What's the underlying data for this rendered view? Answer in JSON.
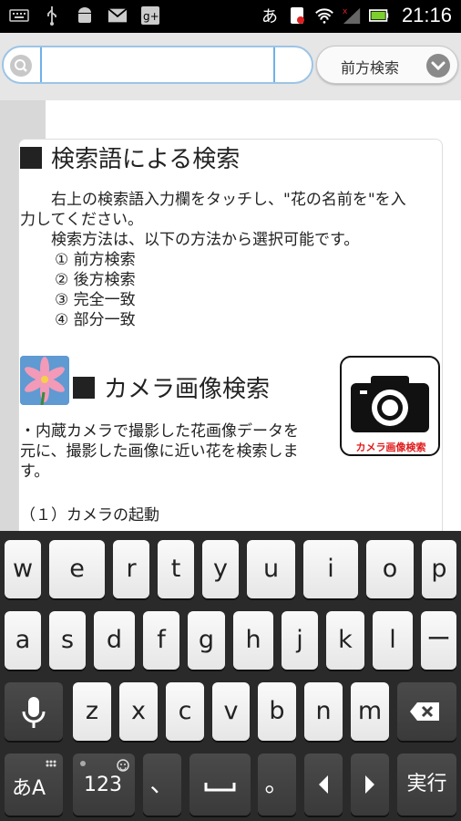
{
  "status_bar": {
    "left_icons": [
      "keyboard-icon",
      "usb-icon",
      "android-icon",
      "gmail-icon",
      "gplus-icon"
    ],
    "right_icons": [
      "ime-a-icon",
      "notification-icon",
      "wifi-icon",
      "signal-icon",
      "battery-icon"
    ],
    "ime_char": "あ",
    "clock": "21:16"
  },
  "search": {
    "input_value": "",
    "mode_label": "前方検索"
  },
  "content": {
    "section1": {
      "title": "検索語による検索",
      "para1_line1": "　　右上の検索語入力欄をタッチし、\"花の名前を\"を入",
      "para1_line2": "力してください。",
      "para2": "　　検索方法は、以下の方法から選択可能です。",
      "options": [
        "① 前方検索",
        "② 後方検索",
        "③ 完全一致",
        "④ 部分一致"
      ]
    },
    "section2": {
      "title": "カメラ画像検索",
      "desc_line1": "・内蔵カメラで撮影した花画像データを",
      "desc_line2": "元に、撮影した画像に近い花を検索しま",
      "desc_line3": "す。",
      "step1": "（１）カメラの起動",
      "camera_badge_label": "カメラ画像検索"
    }
  },
  "keyboard": {
    "row1": [
      "w",
      "e",
      "r",
      "t",
      "y",
      "u",
      "i",
      "o",
      "p"
    ],
    "row2": [
      "a",
      "s",
      "d",
      "f",
      "g",
      "h",
      "j",
      "k",
      "l",
      "ー"
    ],
    "row3": [
      "z",
      "x",
      "c",
      "v",
      "b",
      "n",
      "m"
    ],
    "row4": {
      "mode": "あA",
      "num": "123",
      "comma": "、",
      "period": "。",
      "enter": "実行"
    },
    "colors": {
      "key_light": "#f0f0f0",
      "key_dark": "#3e3e3e",
      "background": "#2a2a2a"
    }
  }
}
